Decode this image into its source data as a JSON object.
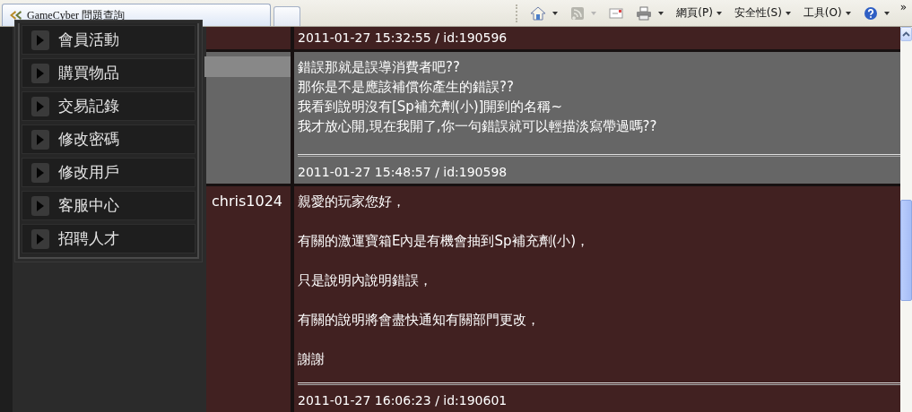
{
  "browser": {
    "tab_title": "GameCyber 問題查詢",
    "menus": [
      "網頁(P)",
      "安全性(S)",
      "工具(O)"
    ],
    "overflow": "»"
  },
  "sidebar": {
    "items": [
      {
        "label": "會員活動"
      },
      {
        "label": "購買物品"
      },
      {
        "label": "交易記錄"
      },
      {
        "label": "修改密碼"
      },
      {
        "label": "修改用戶"
      },
      {
        "label": "客服中心"
      },
      {
        "label": "招聘人才"
      }
    ]
  },
  "posts": [
    {
      "kind": "staff",
      "timestamp": "2011-01-27 15:32:55 / id:190596"
    },
    {
      "kind": "player",
      "lines": [
        "錯誤那就是誤導消費者吧??",
        "那你是不是應該補償你產生的錯誤??",
        "我看到說明沒有[Sp補充劑(小)]開到的名稱~",
        "我才放心開,現在我開了,你一句錯誤就可以輕描淡寫帶過嗎??"
      ],
      "timestamp": "2011-01-27 15:48:57 / id:190598"
    },
    {
      "kind": "staff",
      "author": "chris1024",
      "lines": [
        "親愛的玩家您好，",
        "有關的激運寶箱E內是有機會抽到Sp補充劑(小)，",
        "只是說明內說明錯誤，",
        "有關的說明將會盡快通知有關部門更改，",
        "謝謝"
      ],
      "timestamp": "2011-01-27 16:06:23 / id:190601"
    }
  ]
}
